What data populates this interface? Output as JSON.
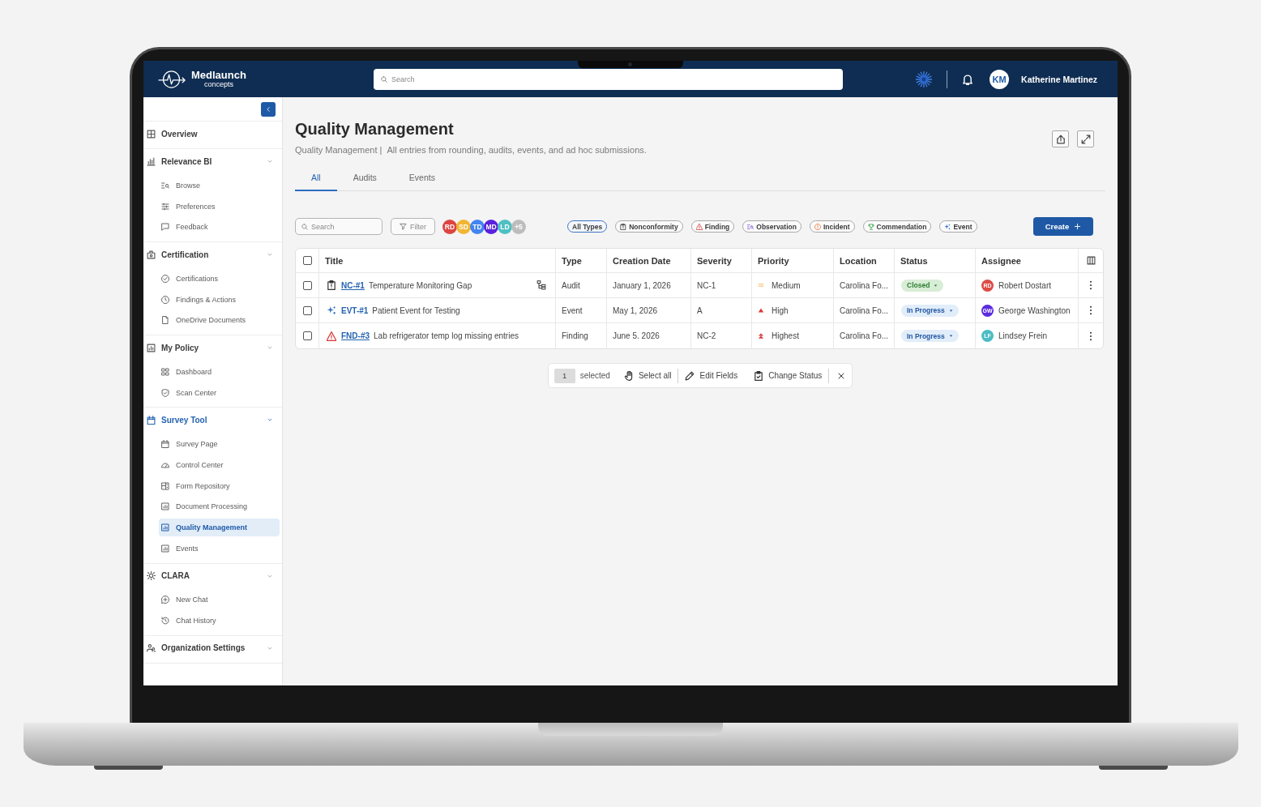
{
  "header": {
    "logo": {
      "name": "Medlaunch",
      "tagline": "concepts"
    },
    "search": {
      "placeholder": "Search"
    },
    "user": {
      "initials": "KM",
      "name": "Katherine Martinez"
    }
  },
  "sidebar": {
    "sections": [
      {
        "label": "Overview",
        "expandable": false,
        "selected": false
      },
      {
        "label": "Relevance BI",
        "expandable": true,
        "selected": false,
        "items": [
          {
            "label": "Browse",
            "selected": false
          },
          {
            "label": "Preferences",
            "selected": false
          },
          {
            "label": "Feedback",
            "selected": false
          }
        ]
      },
      {
        "label": "Certification",
        "expandable": true,
        "selected": false,
        "items": [
          {
            "label": "Certifications",
            "selected": false
          },
          {
            "label": "Findings & Actions",
            "selected": false
          },
          {
            "label": "OneDrive Documents",
            "selected": false
          }
        ]
      },
      {
        "label": "My Policy",
        "expandable": true,
        "selected": false,
        "items": [
          {
            "label": "Dashboard",
            "selected": false
          },
          {
            "label": "Scan Center",
            "selected": false
          }
        ]
      },
      {
        "label": "Survey Tool",
        "expandable": true,
        "selected": true,
        "items": [
          {
            "label": "Survey Page",
            "selected": false
          },
          {
            "label": "Control Center",
            "selected": false
          },
          {
            "label": "Form Repository",
            "selected": false
          },
          {
            "label": "Document Processing",
            "selected": false
          },
          {
            "label": "Quality Management",
            "selected": true
          },
          {
            "label": "Events",
            "selected": false
          }
        ]
      },
      {
        "label": "CLARA",
        "expandable": true,
        "selected": false,
        "items": [
          {
            "label": "New Chat",
            "selected": false
          },
          {
            "label": "Chat History",
            "selected": false
          }
        ]
      },
      {
        "label": "Organization Settings",
        "expandable": true,
        "selected": false
      }
    ]
  },
  "page": {
    "title": "Quality Management",
    "breadcrumb": "Quality Management |",
    "description": "All entries from rounding, audits, events, and ad hoc submissions."
  },
  "tabs": [
    {
      "label": "All",
      "selected": true
    },
    {
      "label": "Audits",
      "selected": false
    },
    {
      "label": "Events",
      "selected": false
    }
  ],
  "toolbar": {
    "search": {
      "placeholder": "Search"
    },
    "filter": "Filter",
    "people": [
      {
        "initials": "RD",
        "color": "#dc4542"
      },
      {
        "initials": "SD",
        "color": "#f2b632"
      },
      {
        "initials": "TD",
        "color": "#4285f0"
      },
      {
        "initials": "MD",
        "color": "#5a22dc"
      },
      {
        "initials": "LD",
        "color": "#4fc0c2"
      }
    ],
    "more_people": "+5",
    "type_filters": [
      {
        "label": "All Types",
        "kind": "all",
        "selected": true
      },
      {
        "label": "Nonconformity",
        "kind": "nonconformity",
        "selected": false
      },
      {
        "label": "Finding",
        "kind": "finding",
        "selected": false
      },
      {
        "label": "Observation",
        "kind": "observation",
        "selected": false
      },
      {
        "label": "Incident",
        "kind": "incident",
        "selected": false
      },
      {
        "label": "Commendation",
        "kind": "commendation",
        "selected": false
      },
      {
        "label": "Event",
        "kind": "event",
        "selected": false
      }
    ],
    "create": "Create"
  },
  "table": {
    "all_selected": false,
    "columns": [
      "Title",
      "Type",
      "Creation Date",
      "Severity",
      "Priority",
      "Location",
      "Status",
      "Assignee"
    ],
    "rows": [
      {
        "selected": false,
        "kind": "nonconformity",
        "id": "NC-#1",
        "underlined": true,
        "title": "Temperature Monitoring Gap",
        "linked": true,
        "type": "Audit",
        "creation_date": "January 1, 2026",
        "severity": "NC-1",
        "priority": {
          "label": "Medium",
          "kind": "medium"
        },
        "location": "Carolina Fo...",
        "status": {
          "label": "Closed",
          "kind": "closed"
        },
        "assignee": {
          "initials": "RD",
          "name": "Robert Dostart",
          "color": "#dc4c46"
        }
      },
      {
        "selected": false,
        "kind": "event",
        "id": "EVT-#1",
        "underlined": false,
        "title": "Patient Event for Testing",
        "linked": false,
        "type": "Event",
        "creation_date": "May 1, 2026",
        "severity": "A",
        "priority": {
          "label": "High",
          "kind": "high"
        },
        "location": "Carolina Fo...",
        "status": {
          "label": "In Progress",
          "kind": "in_progress"
        },
        "assignee": {
          "initials": "GW",
          "name": "George Washington",
          "color": "#5b2be0"
        }
      },
      {
        "selected": false,
        "kind": "finding",
        "id": "FND-#3",
        "underlined": true,
        "title": "Lab refrigerator temp log missing entries",
        "linked": false,
        "type": "Finding",
        "creation_date": "June 5. 2026",
        "severity": "NC-2",
        "priority": {
          "label": "Highest",
          "kind": "highest"
        },
        "location": "Carolina Fo...",
        "status": {
          "label": "In Progress",
          "kind": "in_progress"
        },
        "assignee": {
          "initials": "LF",
          "name": "Lindsey Frein",
          "color": "#4cbcc4"
        }
      }
    ]
  },
  "selection_bar": {
    "count": "1",
    "label": "selected",
    "actions": [
      {
        "label": "Select all",
        "kind": "select_all"
      },
      {
        "label": "Edit Fields",
        "kind": "edit"
      },
      {
        "label": "Change Status",
        "kind": "status"
      }
    ]
  }
}
